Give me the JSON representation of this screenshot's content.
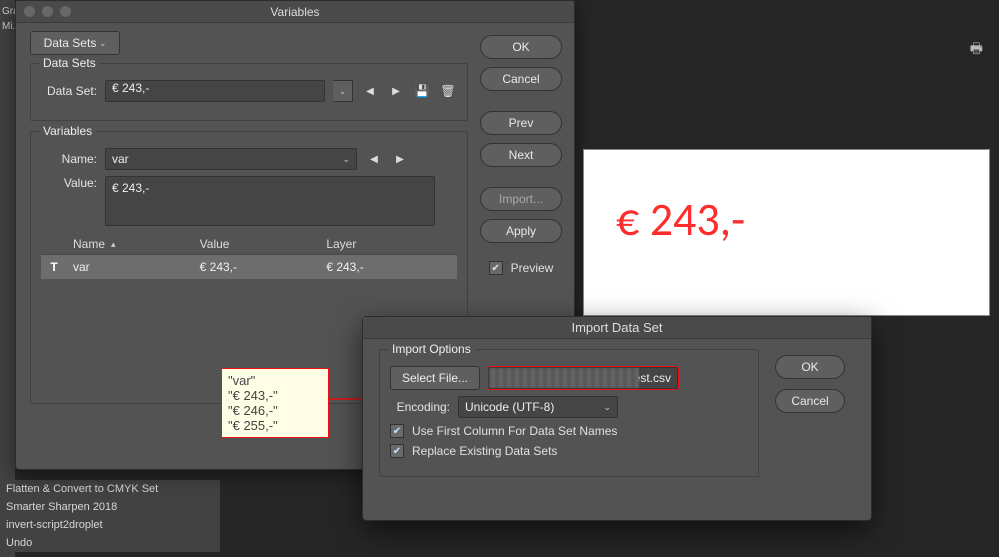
{
  "strip": {
    "top_text": "Gradient M...",
    "top_text2": "Mi..."
  },
  "actions_list": [
    "Flatten & Convert to CMYK Set",
    "Smarter Sharpen 2018",
    "invert-script2droplet",
    "Undo"
  ],
  "variables_dialog": {
    "title": "Variables",
    "tab_label": "Data Sets",
    "data_sets": {
      "legend": "Data Sets",
      "field_label": "Data Set:",
      "value": "€ 243,-"
    },
    "variables": {
      "legend": "Variables",
      "name_label": "Name:",
      "name_value": "var",
      "value_label": "Value:",
      "value_value": "€ 243,-"
    },
    "grid": {
      "cols": [
        "Name",
        "Value",
        "Layer"
      ],
      "row": {
        "icon": "T",
        "name": "var",
        "value": "€ 243,-",
        "layer": "€ 243,-"
      }
    },
    "buttons": {
      "ok": "OK",
      "cancel": "Cancel",
      "prev": "Prev",
      "next": "Next",
      "import": "Import...",
      "apply": "Apply"
    },
    "preview_label": "Preview",
    "preview_checked": true
  },
  "csv": {
    "lines": [
      "\"var\"",
      "\"€ 243,-\"",
      "\"€ 246,-\"",
      "\"€ 255,-\""
    ]
  },
  "canvas_text": "€ 243,-",
  "import_dialog": {
    "title": "Import Data Set",
    "options_legend": "Import Options",
    "select_file_btn": "Select File...",
    "file_name": "test.csv",
    "encoding_label": "Encoding:",
    "encoding_value": "Unicode (UTF-8)",
    "use_first_col": "Use First Column For Data Set Names",
    "replace_existing": "Replace Existing Data Sets",
    "ok": "OK",
    "cancel": "Cancel",
    "use_first_checked": true,
    "replace_checked": true
  }
}
